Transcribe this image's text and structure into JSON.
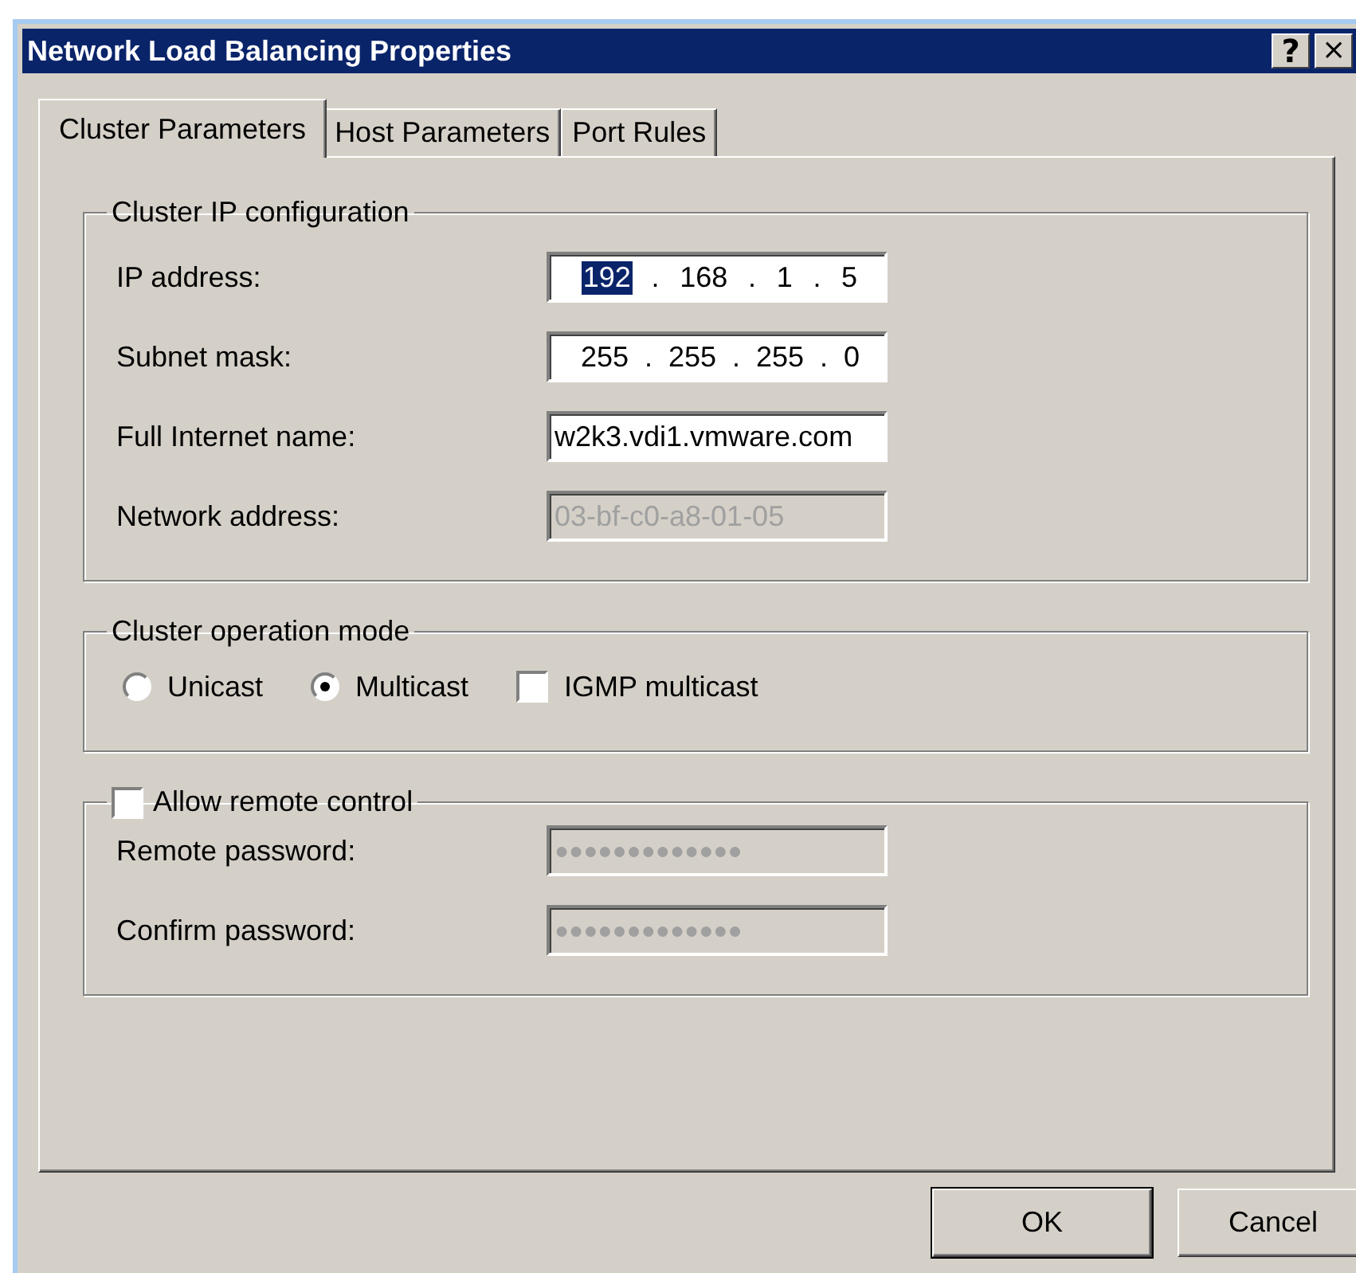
{
  "window": {
    "title": "Network Load Balancing Properties",
    "title_buttons": [
      {
        "kind": "help",
        "label": "?"
      },
      {
        "kind": "close",
        "label": "×"
      }
    ]
  },
  "tabs": [
    {
      "label": "Cluster Parameters",
      "selected": true
    },
    {
      "label": "Host Parameters",
      "selected": false
    },
    {
      "label": "Port Rules",
      "selected": false
    }
  ],
  "groups": [
    {
      "kind": "fields",
      "title": "Cluster IP configuration",
      "fields": [
        {
          "label": "IP address:",
          "kind": "ip",
          "disabled": false,
          "separator": ".",
          "octets": [
            {
              "text": "192",
              "selected": true
            },
            {
              "text": "168",
              "selected": false
            },
            {
              "text": "1",
              "selected": false
            },
            {
              "text": "5",
              "selected": false
            }
          ]
        },
        {
          "label": "Subnet mask:",
          "kind": "ip",
          "disabled": false,
          "separator": ".",
          "octets": [
            {
              "text": "255",
              "selected": false
            },
            {
              "text": "255",
              "selected": false
            },
            {
              "text": "255",
              "selected": false
            },
            {
              "text": "0",
              "selected": false
            }
          ]
        },
        {
          "label": "Full Internet name:",
          "kind": "text",
          "disabled": false,
          "value": "w2k3.vdi1.vmware.com"
        },
        {
          "label": "Network address:",
          "kind": "text",
          "disabled": true,
          "value": "03-bf-c0-a8-01-05"
        }
      ]
    },
    {
      "kind": "options",
      "title": "Cluster operation mode",
      "options": [
        {
          "kind": "radio",
          "label": "Unicast",
          "checked": false
        },
        {
          "kind": "radio",
          "label": "Multicast",
          "checked": true
        },
        {
          "kind": "checkbox",
          "label": "IGMP multicast",
          "checked": false
        }
      ]
    },
    {
      "kind": "fields",
      "title": "Allow remote control",
      "title_checkbox": {
        "checked": false
      },
      "fields": [
        {
          "label": "Remote password:",
          "kind": "text",
          "disabled": true,
          "value": "●●●●●●●●●●●●●"
        },
        {
          "label": "Confirm password:",
          "kind": "text",
          "disabled": true,
          "value": "●●●●●●●●●●●●●"
        }
      ]
    }
  ],
  "buttons": [
    {
      "label": "OK",
      "default": true
    },
    {
      "label": "Cancel",
      "default": false
    }
  ]
}
